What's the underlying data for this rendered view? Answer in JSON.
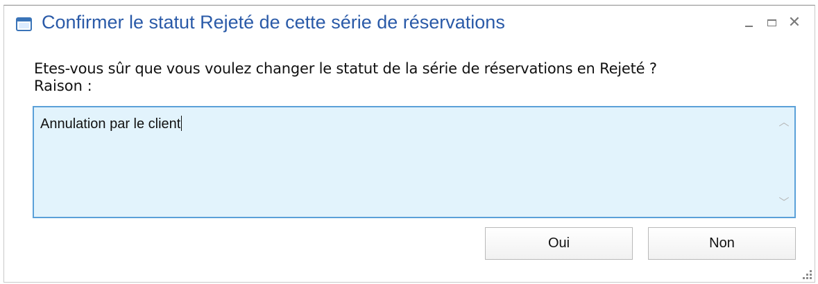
{
  "dialog": {
    "title": "Confirmer le statut Rejeté de cette série de réservations",
    "title_icon": "window-icon",
    "controls": {
      "minimize": "minimize-icon",
      "maximize": "maximize-icon",
      "close_glyph": "✕"
    }
  },
  "body": {
    "question": "Etes-vous sûr que vous voulez changer le statut de la série de réservations en Rejeté ?",
    "reason_label": "Raison :",
    "reason_value": "Annulation par le client",
    "scroll_up_glyph": "︿",
    "scroll_down_glyph": "﹀"
  },
  "buttons": {
    "yes": "Oui",
    "no": "Non"
  },
  "colors": {
    "title": "#2a5aa8",
    "textarea_bg": "#e2f3fc",
    "textarea_border": "#5aa0d8"
  }
}
